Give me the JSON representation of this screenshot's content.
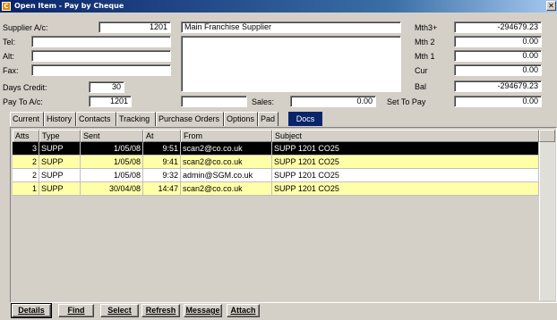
{
  "window": {
    "title": "Open Item - Pay by Cheque",
    "app_icon": "C",
    "close_glyph": "✕"
  },
  "supplier": {
    "account_label": "Supplier A/c:",
    "account_value": "1201",
    "name_value": "Main Franchise Supplier",
    "tel_label": "Tel:",
    "tel_value": "",
    "alt_label": "Alt:",
    "alt_value": "",
    "fax_label": "Fax:",
    "fax_value": "",
    "days_credit_label": "Days Credit:",
    "days_credit_value": "30",
    "pay_to_label": "Pay To A/c:",
    "pay_to_value": "1201",
    "extra_value": "",
    "sales_label": "Sales:",
    "sales_value": "0.00",
    "set_to_pay_label": "Set To Pay",
    "set_to_pay_value": "0.00"
  },
  "balances": {
    "mth3_label": "Mth3+",
    "mth3_value": "-294679.23",
    "mth2_label": "Mth 2",
    "mth2_value": "0.00",
    "mth1_label": "Mth 1",
    "mth1_value": "0.00",
    "cur_label": "Cur",
    "cur_value": "0.00",
    "bal_label": "Bal",
    "bal_value": "-294679.23"
  },
  "tabs": [
    "Current",
    "History",
    "Contacts",
    "Tracking",
    "Purchase Orders",
    "Options",
    "Pad",
    "Docs"
  ],
  "grid": {
    "columns": [
      "Atts",
      "Type",
      "Sent",
      "At",
      "From",
      "Subject"
    ],
    "rows": [
      {
        "atts": "3",
        "type": "SUPP",
        "sent": "1/05/08",
        "at": "9:51",
        "from": "scan2@co.co.uk",
        "subject": "SUPP 1201 CO25"
      },
      {
        "atts": "2",
        "type": "SUPP",
        "sent": "1/05/08",
        "at": "9:41",
        "from": "scan2@co.co.uk",
        "subject": "SUPP 1201 CO25"
      },
      {
        "atts": "2",
        "type": "SUPP",
        "sent": "1/05/08",
        "at": "9:32",
        "from": "admin@SGM.co.uk",
        "subject": "SUPP 1201 CO25"
      },
      {
        "atts": "1",
        "type": "SUPP",
        "sent": "30/04/08",
        "at": "14:47",
        "from": "scan2@co.co.uk",
        "subject": "SUPP 1201 CO25"
      }
    ]
  },
  "buttons": {
    "details": "Details",
    "find": "Find",
    "select": "Select",
    "refresh": "Refresh",
    "message": "Message",
    "attach": "Attach"
  }
}
